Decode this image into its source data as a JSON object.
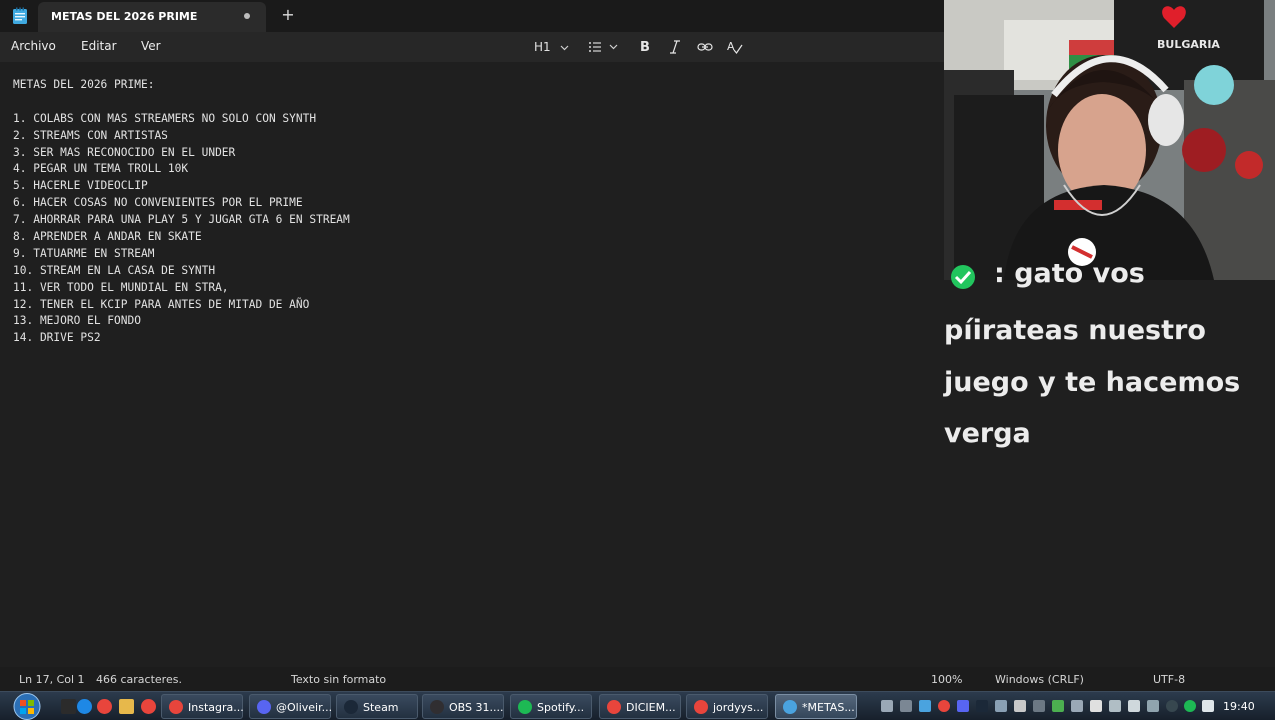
{
  "window": {
    "tab_title": "METAS DEL 2026 PRIME",
    "new_tab_label": "+"
  },
  "menu": {
    "items": [
      "Archivo",
      "Editar",
      "Ver"
    ],
    "heading_label": "H1"
  },
  "document": {
    "lines": [
      "METAS DEL 2026 PRIME:",
      "",
      "1. COLABS CON MAS STREAMERS NO SOLO CON SYNTH",
      "2. STREAMS CON ARTISTAS",
      "3. SER MAS RECONOCIDO EN EL UNDER",
      "4. PEGAR UN TEMA TROLL 10K",
      "5. HACERLE VIDEOCLIP",
      "6. HACER COSAS NO CONVENIENTES POR EL PRIME",
      "7. AHORRAR PARA UNA PLAY 5 Y JUGAR GTA 6 EN STREAM",
      "8. APRENDER A ANDAR EN SKATE",
      "9. TATUARME EN STREAM",
      "10. STREAM EN LA CASA DE SYNTH",
      "11. VER TODO EL MUNDIAL EN STRA,",
      "12. TENER EL KCIP PARA ANTES DE MITAD DE AÑO",
      "13. MEJORO EL FONDO",
      "14. DRIVE PS2"
    ]
  },
  "chat": {
    "first_line": ": gato vos",
    "lines": [
      "píirateas nuestro",
      "juego y te hacemos",
      "verga"
    ]
  },
  "status": {
    "position": "Ln 17, Col 1",
    "chars": "466 caracteres.",
    "format": "Texto sin formato",
    "zoom": "100%",
    "line_ending": "Windows (CRLF)",
    "encoding": "UTF-8"
  },
  "taskbar": {
    "buttons": [
      {
        "label": "Instagra...",
        "icon": "chrome-icon",
        "color": "#e8453c"
      },
      {
        "label": "@Oliveir...",
        "icon": "discord-icon",
        "color": "#5865f2"
      },
      {
        "label": "Steam",
        "icon": "steam-icon",
        "color": "#1b2838"
      },
      {
        "label": "OBS 31....",
        "icon": "obs-icon",
        "color": "#302e31"
      },
      {
        "label": "Spotify...",
        "icon": "spotify-icon",
        "color": "#1db954"
      },
      {
        "label": "DICIEM...",
        "icon": "chrome-icon",
        "color": "#e8453c"
      },
      {
        "label": "jordyys...",
        "icon": "chrome-icon",
        "color": "#e8453c"
      },
      {
        "label": "*METAS...",
        "icon": "notepad-icon",
        "color": "#4aa3df"
      }
    ],
    "clock": "19:40"
  },
  "colors": {
    "editor_bg": "#1f1f1f",
    "chat_check": "#22c55e"
  }
}
